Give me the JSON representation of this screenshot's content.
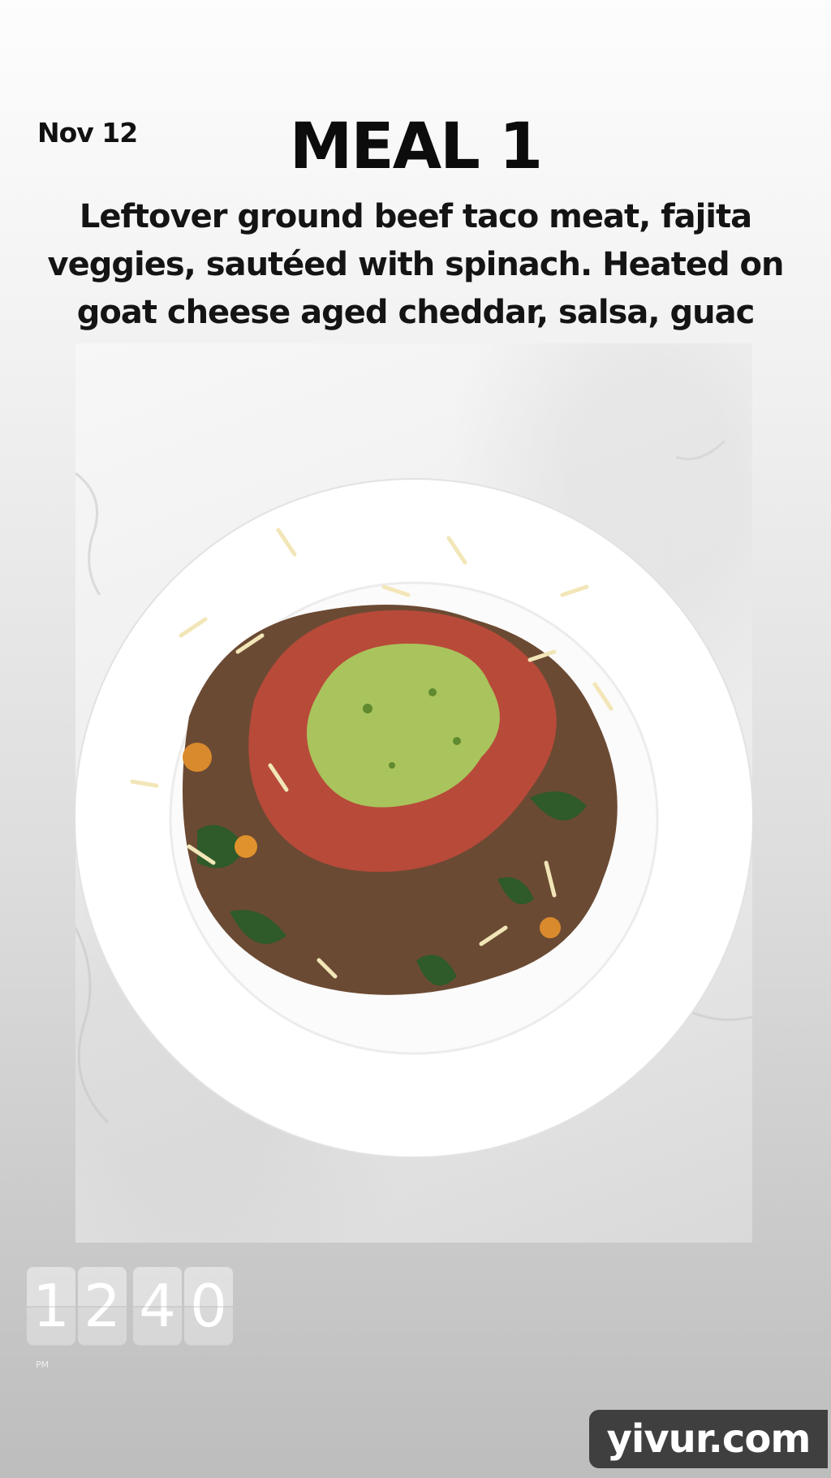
{
  "story": {
    "date": "Nov 12",
    "title": "MEAL 1",
    "caption": "Leftover ground beef taco meat, fajita veggies, sautéed with spinach. Heated on goat cheese aged cheddar, salsa, guac"
  },
  "timer_sticker": {
    "hour_digits": [
      "1",
      "2"
    ],
    "minute_digits": [
      "4",
      "0"
    ],
    "period": "PM"
  },
  "watermark": {
    "text": "yivur.com"
  },
  "colors": {
    "text": "#111111",
    "watermark_bg": "#3f3f3f",
    "plate": "#ffffff",
    "guacamole": "#a9c45c",
    "salsa": "#b84a3a",
    "taco_meat": "#6b4a33",
    "spinach": "#2f5a2a"
  }
}
